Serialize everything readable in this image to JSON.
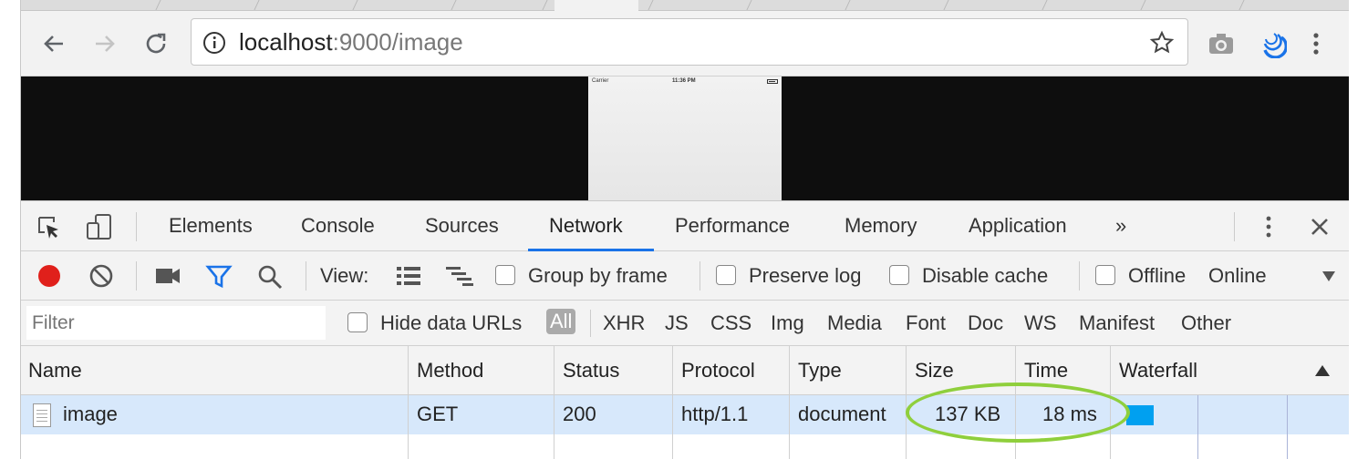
{
  "browser": {
    "url_host": "localhost",
    "url_rest": ":9000/image"
  },
  "device": {
    "carrier": "Carrier",
    "time": "11:36 PM"
  },
  "devtools": {
    "tabs": [
      "Elements",
      "Console",
      "Sources",
      "Network",
      "Performance",
      "Memory",
      "Application"
    ],
    "active_tab": "Network",
    "more_tabs": "»",
    "controls": {
      "view_label": "View:",
      "group_by_frame": "Group by frame",
      "preserve_log": "Preserve log",
      "disable_cache": "Disable cache",
      "offline": "Offline",
      "throttling": "Online"
    },
    "filter": {
      "placeholder": "Filter",
      "hide_data_urls": "Hide data URLs",
      "types": [
        "All",
        "XHR",
        "JS",
        "CSS",
        "Img",
        "Media",
        "Font",
        "Doc",
        "WS",
        "Manifest",
        "Other"
      ],
      "active_type": "All"
    },
    "table": {
      "columns": [
        "Name",
        "Method",
        "Status",
        "Protocol",
        "Type",
        "Size",
        "Time",
        "Waterfall"
      ],
      "rows": [
        {
          "name": "image",
          "method": "GET",
          "status": "200",
          "protocol": "http/1.1",
          "type": "document",
          "size": "137 KB",
          "time": "18 ms"
        }
      ]
    }
  },
  "colors": {
    "accent": "#1a73e8",
    "record": "#e0201b",
    "filter_active": "#1a73e8",
    "waterfall_bar": "#00a0f0",
    "highlight_ring": "#8fcf3c",
    "selected_row": "#d7e8fb"
  }
}
